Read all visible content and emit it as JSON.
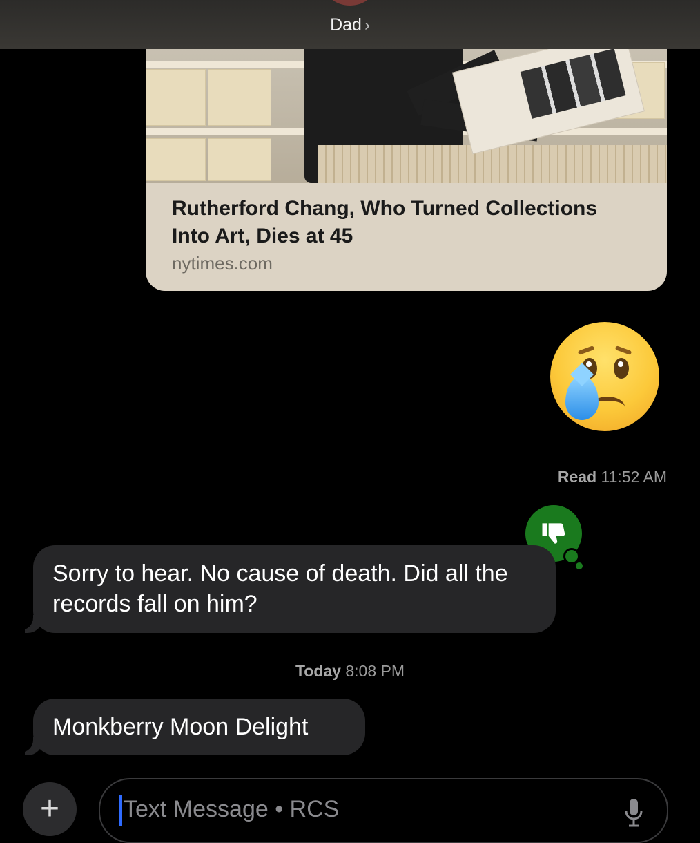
{
  "header": {
    "contact_name": "Dad",
    "chevron": "›"
  },
  "link_preview": {
    "title": "Rutherford Chang, Who Turned Collections Into Art, Dies at 45",
    "domain": "nytimes.com"
  },
  "sent_emoji": {
    "name": "crying-face"
  },
  "read_receipt": {
    "label": "Read",
    "time": "11:52 AM"
  },
  "tapback": {
    "icon": "thumbs-down-icon",
    "color": "#1a7a1e"
  },
  "messages": [
    {
      "text": "Sorry to hear.  No cause of death. Did all the records fall on him?"
    },
    {
      "text": "Monkberry Moon Delight"
    }
  ],
  "timestamp": {
    "day": "Today",
    "time": "8:08 PM"
  },
  "compose": {
    "placeholder": "Text Message • RCS",
    "plus_label": "+"
  },
  "colors": {
    "incoming_bubble": "#262628",
    "cursor": "#2f6bff",
    "background": "#000000"
  }
}
